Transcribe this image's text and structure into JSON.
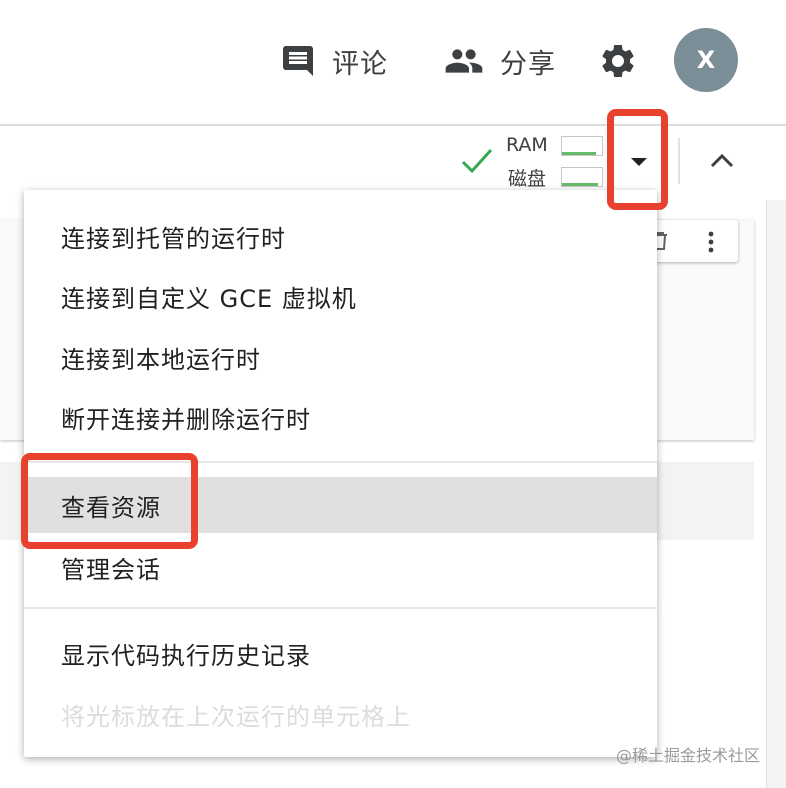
{
  "header": {
    "comment_label": "评论",
    "share_label": "分享",
    "avatar_initial": "X",
    "settings_icon": "gear-icon",
    "comment_icon": "comment-icon",
    "share_icon": "people-icon"
  },
  "resources": {
    "ram_label": "RAM",
    "disk_label": "磁盘",
    "status_icon": "check-icon",
    "status_color": "#34a853"
  },
  "menu": {
    "items": [
      {
        "label": "连接到托管的运行时"
      },
      {
        "label": "连接到自定义 GCE 虚拟机"
      },
      {
        "label": "连接到本地运行时"
      },
      {
        "label": "断开连接并删除运行时"
      },
      {
        "label": "查看资源",
        "highlighted": true
      },
      {
        "label": "管理会话"
      },
      {
        "label": "显示代码执行历史记录"
      },
      {
        "label": "将光标放在上次运行的单元格上",
        "disabled": true
      }
    ]
  },
  "annotation_color": "#e8422f",
  "watermark": "@稀土掘金技术社区"
}
